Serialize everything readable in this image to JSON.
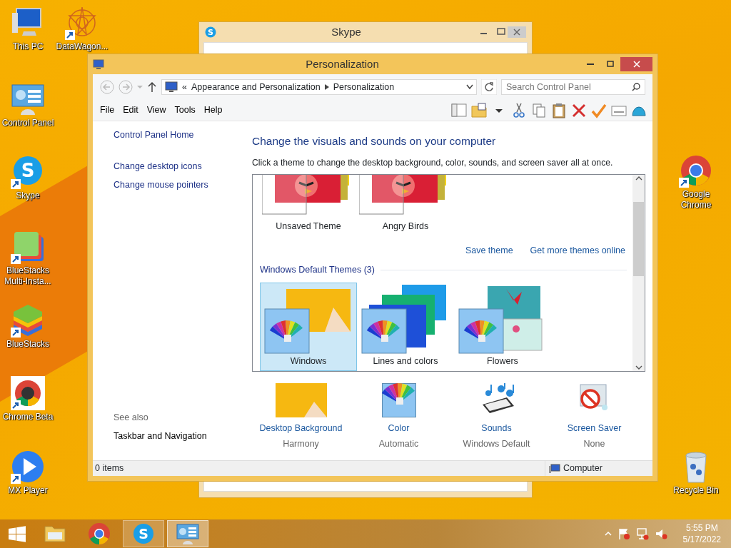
{
  "desktop_icons": [
    {
      "kind": "pc",
      "label": "This PC",
      "shortcut": false
    },
    {
      "kind": "star",
      "label": "DataWagon...",
      "shortcut": true
    },
    {
      "kind": "controlpanel",
      "label": "Control Panel",
      "shortcut": false
    },
    {
      "kind": "skype",
      "label": "Skype",
      "shortcut": true,
      "glyph": "S"
    },
    {
      "kind": "bluestacks-multi",
      "label": "BlueStacks Multi-Insta...",
      "shortcut": true
    },
    {
      "kind": "bluestacks",
      "label": "BlueStacks",
      "shortcut": true
    },
    {
      "kind": "chrome-beta",
      "label": "Chrome Beta",
      "shortcut": true
    },
    {
      "kind": "player",
      "label": "MX Player",
      "shortcut": true
    },
    {
      "kind": "chrome",
      "label": "Google Chrome",
      "shortcut": true
    },
    {
      "kind": "bin",
      "label": "Recycle Bin",
      "shortcut": false
    }
  ],
  "skype_window": {
    "title": "Skype",
    "icon_glyph": "S"
  },
  "window": {
    "title": "Personalization",
    "address": {
      "overflow": "«",
      "breadcrumb": [
        "Appearance and Personalization",
        "Personalization"
      ],
      "search_placeholder": "Search Control Panel"
    },
    "menu": [
      "File",
      "Edit",
      "View",
      "Tools",
      "Help"
    ],
    "sidebar": {
      "home": "Control Panel Home",
      "links": [
        "Change desktop icons",
        "Change mouse pointers"
      ],
      "see_also": "See also",
      "see_also_links": [
        "Taskbar and Navigation"
      ]
    },
    "heading": "Change the visuals and sounds on your computer",
    "description": "Click a theme to change the desktop background, color, sounds, and screen saver all at once.",
    "my_themes": [
      {
        "label": "Unsaved Theme",
        "kind": "birds",
        "selected": false
      },
      {
        "label": "Angry Birds",
        "kind": "birds",
        "selected": false
      }
    ],
    "theme_links": [
      "Save theme",
      "Get more themes online"
    ],
    "group_title": "Windows Default Themes (3)",
    "default_themes": [
      {
        "label": "Windows",
        "kind": "windows",
        "selected": true
      },
      {
        "label": "Lines and colors",
        "kind": "lines",
        "selected": false
      },
      {
        "label": "Flowers",
        "kind": "flowers",
        "selected": false
      }
    ],
    "settings": [
      {
        "kind": "background",
        "label": "Desktop Background",
        "value": "Harmony"
      },
      {
        "kind": "color",
        "label": "Color",
        "value": "Automatic"
      },
      {
        "kind": "sounds",
        "label": "Sounds",
        "value": "Windows Default"
      },
      {
        "kind": "screensaver",
        "label": "Screen Saver",
        "value": "None"
      }
    ],
    "status_bar": {
      "items": "0 items",
      "location": "Computer"
    }
  },
  "taskbar": {
    "apps": [
      {
        "kind": "explorer",
        "running": false,
        "selected": false
      },
      {
        "kind": "chrome",
        "running": false,
        "selected": false
      },
      {
        "kind": "skype",
        "running": true,
        "selected": false,
        "glyph": "S"
      },
      {
        "kind": "controlpanel",
        "running": true,
        "selected": true
      }
    ],
    "time": "5:55 PM",
    "date": "5/17/2022"
  }
}
